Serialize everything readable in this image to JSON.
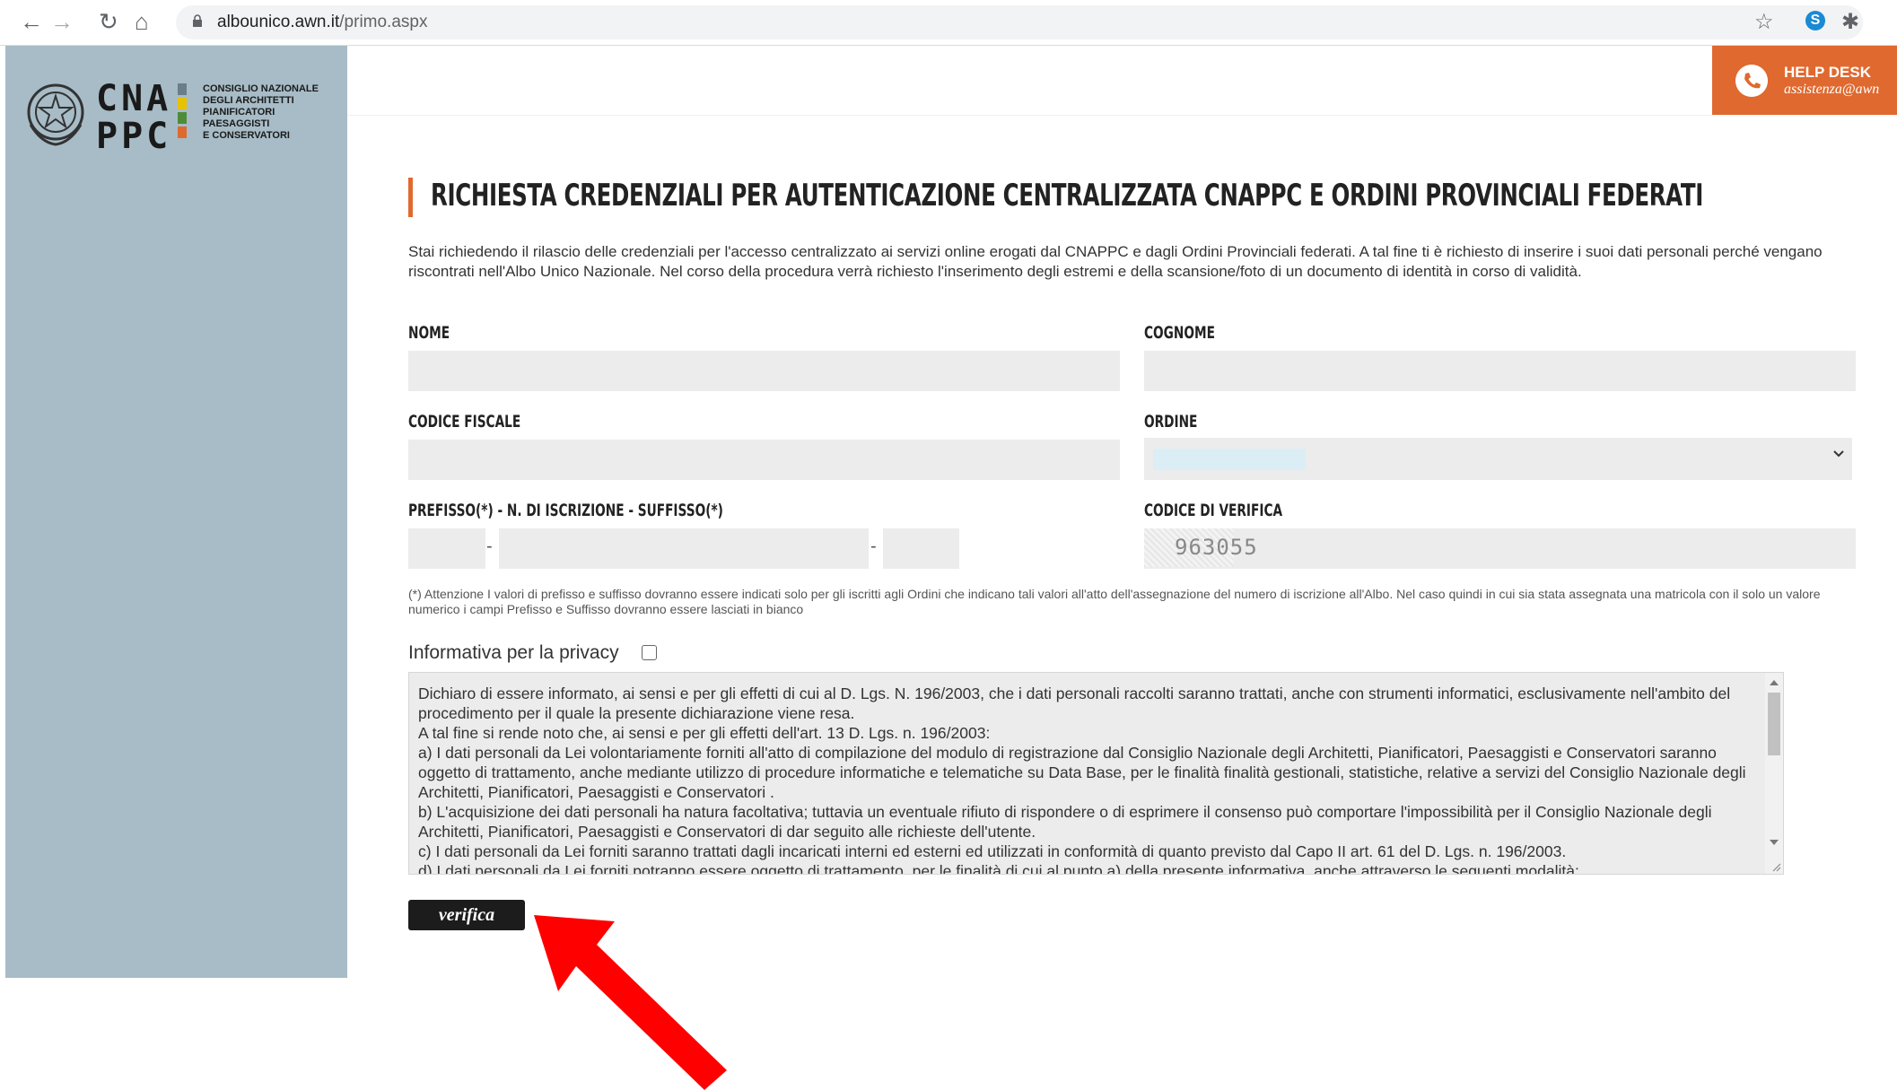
{
  "browser": {
    "url_host": "albounico.awn.it",
    "url_path": "/primo.aspx"
  },
  "sidebar": {
    "logo_letters_top": "CNA",
    "logo_letters_bottom": "PPC",
    "org_lines": [
      "Consiglio Nazionale",
      "degli Architetti",
      "Pianificatori",
      "Paesaggisti",
      "e Conservatori"
    ]
  },
  "helpdesk": {
    "title": "HELP DESK",
    "email": "assistenza@awn"
  },
  "main": {
    "title": "RICHIESTA CREDENZIALI PER AUTENTICAZIONE CENTRALIZZATA CNAPPC E ORDINI PROVINCIALI FEDERATI",
    "intro": "Stai richiedendo il rilascio delle credenziali per l'accesso centralizzato ai servizi online erogati dal CNAPPC e dagli Ordini Provinciali federati. A tal fine ti è richiesto di inserire i suoi dati personali perché vengano riscontrati nell'Albo Unico Nazionale. Nel corso della procedura verrà richiesto l'inserimento degli estremi e della scansione/foto di un documento di identità in corso di validità."
  },
  "form": {
    "nome_label": "NOME",
    "cognome_label": "COGNOME",
    "codice_fiscale_label": "CODICE FISCALE",
    "ordine_label": "ORDINE",
    "iscrizione_label": "PREFISSO(*) - N. DI ISCRIZIONE - SUFFISSO(*)",
    "verifica_label": "CODICE DI VERIFICA",
    "captcha_value": "963055",
    "separator": "-",
    "note": "(*) Attenzione I valori di prefisso e suffisso dovranno essere indicati solo per gli iscritti agli Ordini che indicano tali valori all'atto dell'assegnazione del numero di iscrizione all'Albo. Nel caso quindi in cui sia stata assegnata una matricola con il solo un valore numerico i campi Prefisso e Suffisso dovranno essere lasciati in bianco"
  },
  "privacy": {
    "label": "Informativa per la privacy",
    "lines": [
      "Dichiaro di essere informato, ai sensi e per gli effetti di cui al D. Lgs. N. 196/2003, che i dati personali raccolti saranno trattati, anche con strumenti informatici, esclusivamente nell'ambito del procedimento per il quale la presente dichiarazione viene resa.",
      "A tal fine si rende noto che, ai sensi e per gli effetti dell'art. 13 D. Lgs. n. 196/2003:",
      "a)    I dati personali da Lei volontariamente forniti all'atto di compilazione del modulo di registrazione dal Consiglio Nazionale degli Architetti, Pianificatori, Paesaggisti e Conservatori saranno oggetto di trattamento, anche mediante utilizzo di procedure informatiche e telematiche su Data Base, per le finalità finalità gestionali, statistiche, relative a  servizi del Consiglio Nazionale degli Architetti, Pianificatori, Paesaggisti e Conservatori .",
      "b)    L'acquisizione dei dati personali ha natura facoltativa; tuttavia un eventuale rifiuto di rispondere o di esprimere il consenso può comportare l'impossibilità per il Consiglio Nazionale degli Architetti, Pianificatori, Paesaggisti e Conservatori di dar seguito alle richieste dell'utente.",
      "c)    I dati personali da Lei forniti saranno trattati dagli incaricati interni ed esterni ed utilizzati in conformità di quanto previsto dal Capo II art. 61 del D. Lgs. n. 196/2003.",
      "d)    I dati personali da Lei forniti potranno essere oggetto di trattamento, per le finalità di cui al punto a) della presente informativa, anche attraverso le seguenti modalità:"
    ]
  },
  "button": {
    "verifica": "verifica"
  },
  "colors": {
    "accent": "#e0692f",
    "sidebar": "#a7bcc6",
    "arrow": "#ff0000"
  }
}
